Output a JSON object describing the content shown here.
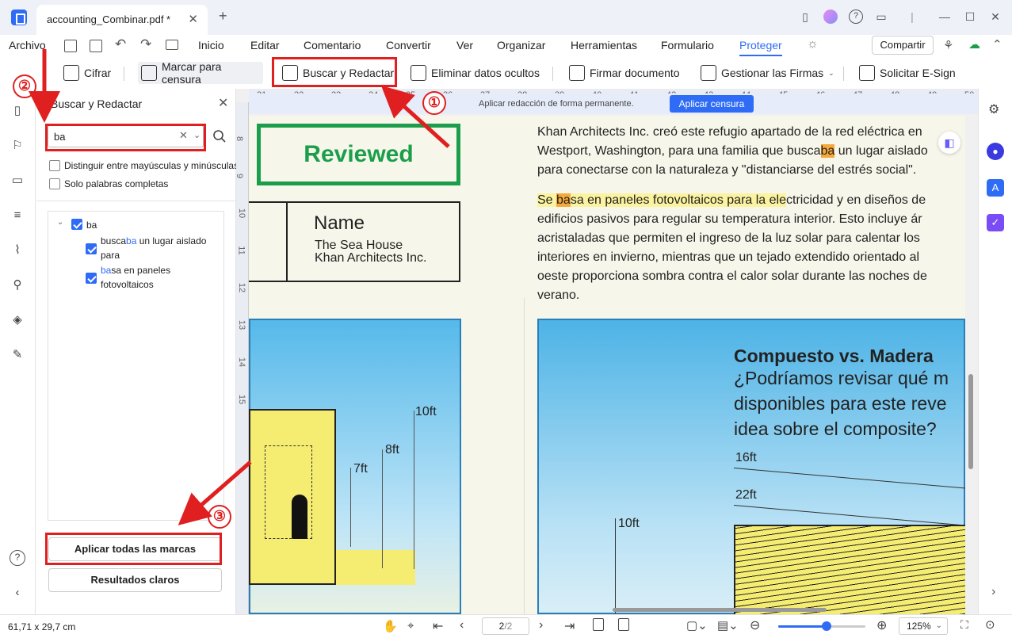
{
  "window": {
    "tab_title": "accounting_Combinar.pdf *",
    "close_glyph": "✕",
    "new_tab_glyph": "+"
  },
  "menu": {
    "file": "Archivo",
    "items": [
      "Inicio",
      "Editar",
      "Comentario",
      "Convertir",
      "Ver",
      "Organizar",
      "Herramientas",
      "Formulario",
      "Proteger"
    ],
    "active": "Proteger",
    "share": "Compartir"
  },
  "toolbar": {
    "encrypt": "Cifrar",
    "mark_redact": "Marcar para censura",
    "search_redact": "Buscar y Redactar",
    "remove_hidden": "Eliminar datos ocultos",
    "sign": "Firmar documento",
    "manage_signatures": "Gestionar las Firmas",
    "request_esign": "Solicitar E-Sign"
  },
  "panel": {
    "title": "Buscar y Redactar",
    "search_value": "ba",
    "opt_case": "Distinguir entre mayúsculas y minúsculas",
    "opt_whole": "Solo palabras completas",
    "root_label": "ba",
    "results": [
      {
        "pre": "busca",
        "term": "ba",
        "post": " un lugar aislado",
        "line2": "para"
      },
      {
        "pre": "",
        "term": "ba",
        "post": "sa en paneles",
        "line2": "fotovoltaicos"
      }
    ],
    "apply_all": "Aplicar todas las marcas",
    "clear": "Resultados claros"
  },
  "redact_bar": {
    "message": "Aplicar redacción de forma permanente.",
    "button": "Aplicar censura"
  },
  "ruler": {
    "top": [
      "31",
      "32",
      "33",
      "34",
      "35",
      "36",
      "37",
      "38",
      "39",
      "40",
      "41",
      "42",
      "43",
      "44",
      "45",
      "46",
      "47",
      "48",
      "49",
      "50"
    ],
    "left": [
      "8",
      "9",
      "10",
      "11",
      "12",
      "13",
      "14",
      "15"
    ]
  },
  "document": {
    "stamp": "Reviewed",
    "name_heading": "Name",
    "name_line1": "The Sea House",
    "name_line2": "Khan Architects Inc.",
    "para1": [
      "Khan Architects Inc. creó este refugio apartado de la red eléctrica en",
      "Westport, Washington, para una familia que busca",
      "ba",
      " un lugar aislado",
      "para conectarse con la naturaleza y \"distanciarse del estrés social\"."
    ],
    "para2_first_pre": "Se ",
    "para2_first_term": "ba",
    "para2_first_post": "sa en paneles fotovoltaicos para la ele",
    "para2_first_rest": "ctricidad y en diseños de",
    "para2_lines": [
      "edificios pasivos para regular su temperatura interior. Esto incluye ár",
      "acristaladas que permiten el ingreso de la luz solar para calentar los",
      "interiores en invierno, mientras que un tejado extendido orientado al",
      "oeste proporciona sombra contra el calor solar durante las noches de",
      "verano."
    ],
    "chart_heading": "Compuesto vs. Madera",
    "chart_q1": "¿Podríamos revisar qué m",
    "chart_q2": "disponibles para este reve",
    "chart_q3": "idea sobre el composite?",
    "dims_left": [
      "10ft",
      "8ft",
      "7ft"
    ],
    "dims_right": [
      "16ft",
      "22ft",
      "10ft"
    ]
  },
  "annotations": {
    "step1": "①",
    "step2": "②",
    "step3": "③"
  },
  "status": {
    "page_size": "61,71 x 29,7 cm",
    "page_current": "2",
    "page_total": "/2",
    "zoom": "125%",
    "zoom_level": 0.55
  },
  "colors": {
    "accent": "#2f6cf6",
    "annotation_red": "#e02020",
    "stamp_green": "#1a9e4b"
  },
  "icons": [
    "bookmark-icon",
    "help-icon",
    "minimize-icon",
    "maximize-icon",
    "close-icon"
  ]
}
